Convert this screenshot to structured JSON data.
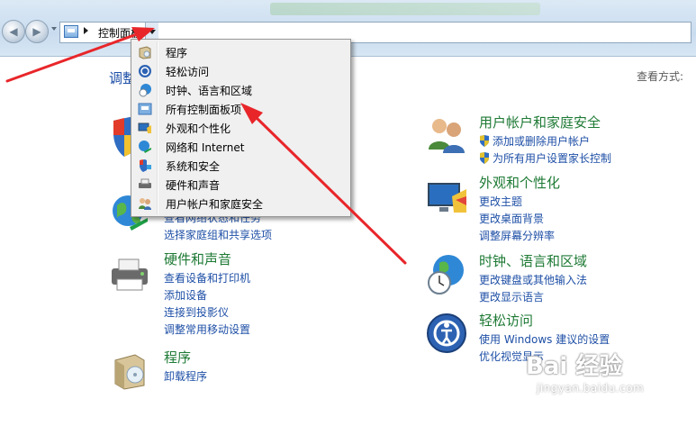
{
  "address": {
    "path": "控制面板"
  },
  "header": {
    "title_partial": "调整",
    "view_by": "查看方式:"
  },
  "menu": {
    "items": [
      {
        "label": "程序",
        "icon": "programs-icon"
      },
      {
        "label": "轻松访问",
        "icon": "ease-of-access-icon"
      },
      {
        "label": "时钟、语言和区域",
        "icon": "clock-language-region-icon"
      },
      {
        "label": "所有控制面板项",
        "icon": "all-control-panel-items-icon"
      },
      {
        "label": "外观和个性化",
        "icon": "appearance-icon"
      },
      {
        "label": "网络和 Internet",
        "icon": "network-icon"
      },
      {
        "label": "系统和安全",
        "icon": "system-security-icon"
      },
      {
        "label": "硬件和声音",
        "icon": "hardware-sound-icon"
      },
      {
        "label": "用户帐户和家庭安全",
        "icon": "user-accounts-icon"
      }
    ]
  },
  "left": {
    "network": {
      "links": [
        "查看网络状态和任务",
        "选择家庭组和共享选项"
      ]
    },
    "hardware": {
      "title": "硬件和声音",
      "links": [
        "查看设备和打印机",
        "添加设备",
        "连接到投影仪",
        "调整常用移动设置"
      ]
    },
    "programs": {
      "title": "程序",
      "links": [
        "卸载程序"
      ]
    }
  },
  "right": {
    "users": {
      "title": "用户帐户和家庭安全",
      "links": [
        "添加或删除用户帐户",
        "为所有用户设置家长控制"
      ]
    },
    "appearance": {
      "title": "外观和个性化",
      "links": [
        "更改主题",
        "更改桌面背景",
        "调整屏幕分辨率"
      ]
    },
    "clock": {
      "title": "时钟、语言和区域",
      "links": [
        "更改键盘或其他输入法",
        "更改显示语言"
      ]
    },
    "ease": {
      "title": "轻松访问",
      "links": [
        "使用 Windows 建议的设置",
        "优化视觉显示"
      ]
    }
  },
  "watermark": {
    "brand": "Bai 经验",
    "url": "jingyan.baidu.com"
  },
  "colors": {
    "link": "#1e4fa6",
    "category": "#1e7a35",
    "arrow": "#e8262a"
  }
}
